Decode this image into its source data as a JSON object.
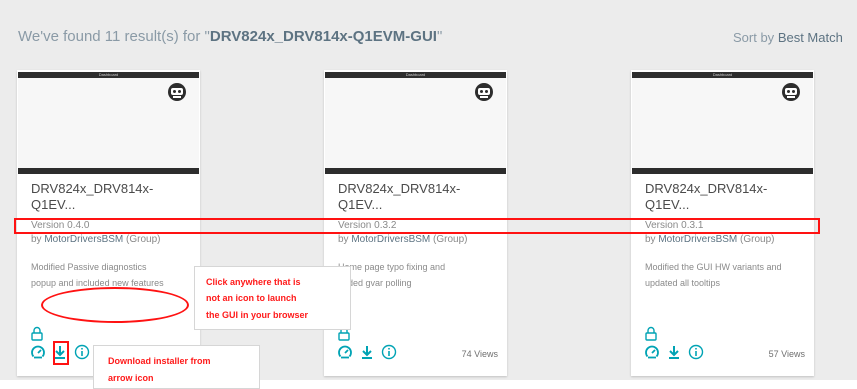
{
  "header": {
    "prefix": "We've found 11 result(s) for \"",
    "query": "DRV824x_DRV814x-Q1EVM-GUI",
    "suffix": "\""
  },
  "sort": {
    "label": "Sort by",
    "value": "Best Match"
  },
  "cards": [
    {
      "thumb_title": "Dashboard",
      "title_line1": "DRV824x_DRV814x-",
      "title_line2": "Q1EV...",
      "version": "Version 0.4.0",
      "by": "by",
      "author": "MotorDriversBSM",
      "author_type": "(Group)",
      "desc_line1": "Modified Passive diagnostics",
      "desc_line2": "popup and included new features",
      "views": ""
    },
    {
      "thumb_title": "Dashboard",
      "title_line1": "DRV824x_DRV814x-",
      "title_line2": "Q1EV...",
      "version": "Version 0.3.2",
      "by": "by",
      "author": "MotorDriversBSM",
      "author_type": "(Group)",
      "desc_line1": "Home page typo fixing and",
      "desc_line2": "added gvar polling",
      "views": "74 Views"
    },
    {
      "thumb_title": "Dashboard",
      "title_line1": "DRV824x_DRV814x-",
      "title_line2": "Q1EV...",
      "version": "Version 0.3.1",
      "by": "by",
      "author": "MotorDriversBSM",
      "author_type": "(Group)",
      "desc_line1": "Modified the GUI HW variants and",
      "desc_line2": "updated all tooltips",
      "views": "57 Views"
    }
  ],
  "annotations": {
    "launch_line1": "Click anywhere that is",
    "launch_line2": "not an icon to launch",
    "launch_line3": "the GUI in your browser",
    "download_line1": "Download installer from",
    "download_line2": "arrow icon"
  },
  "colors": {
    "accent": "#00a3b4",
    "highlight": "#ff1212",
    "query_text": "#5d7382"
  },
  "icons": [
    "dashboard-robot-icon",
    "lock-icon",
    "gauge-icon",
    "download-arrow-icon",
    "info-icon"
  ]
}
